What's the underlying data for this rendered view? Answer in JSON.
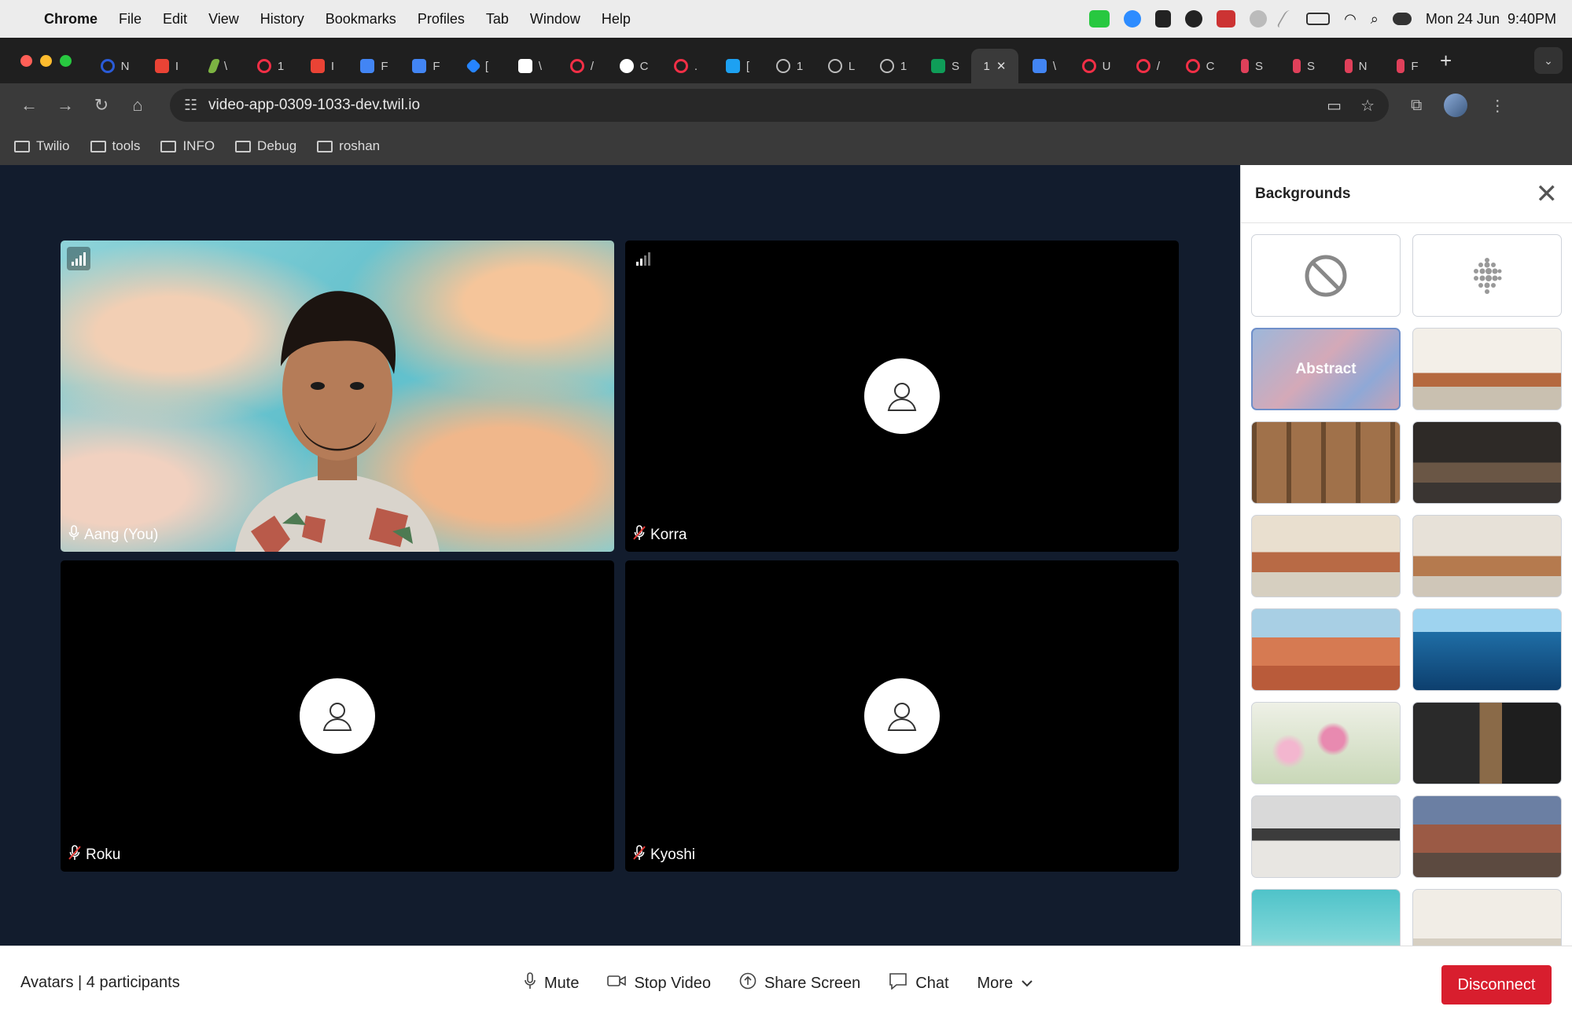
{
  "menubar": {
    "app": "Chrome",
    "items": [
      "File",
      "Edit",
      "View",
      "History",
      "Bookmarks",
      "Profiles",
      "Tab",
      "Window",
      "Help"
    ],
    "datetime": "Mon 24 Jun  9:40PM"
  },
  "browser": {
    "address": "video-app-0309-1033-dev.twil.io",
    "tabs": [
      "N",
      "I",
      "\\",
      "1",
      "I",
      "F",
      "F",
      "[",
      "\\",
      "/",
      "C",
      ".",
      "[",
      "1",
      "L",
      "1",
      "S",
      "1",
      "\\",
      "U",
      "/",
      "C",
      "S",
      "S",
      "N",
      "F"
    ],
    "bookmarks": [
      "Twilio",
      "tools",
      "INFO",
      "Debug",
      "roshan"
    ]
  },
  "participants": [
    {
      "name": "Aang (You)",
      "video": true
    },
    {
      "name": "Korra",
      "video": false
    },
    {
      "name": "Roku",
      "video": false
    },
    {
      "name": "Kyoshi",
      "video": false
    }
  ],
  "sidebar": {
    "title": "Backgrounds",
    "selected_label": "Abstract",
    "options": [
      "none-icon",
      "blur-icon",
      "abstract",
      "living-room",
      "bookshelf",
      "coffee-shop",
      "lounge",
      "sunroom",
      "desert",
      "ocean",
      "flowers",
      "kitchen",
      "modern-home",
      "canyon",
      "beach",
      "white-interior"
    ]
  },
  "controlbar": {
    "room": "Avatars",
    "participants_count": "4 participants",
    "mute_label": "Mute",
    "stop_video_label": "Stop Video",
    "share_screen_label": "Share Screen",
    "chat_label": "Chat",
    "more_label": "More",
    "disconnect_label": "Disconnect"
  },
  "colors": {
    "stage_bg": "#121c2d",
    "disconnect": "#d81e2e",
    "selected_thumb_border": "#6f8fc9"
  }
}
